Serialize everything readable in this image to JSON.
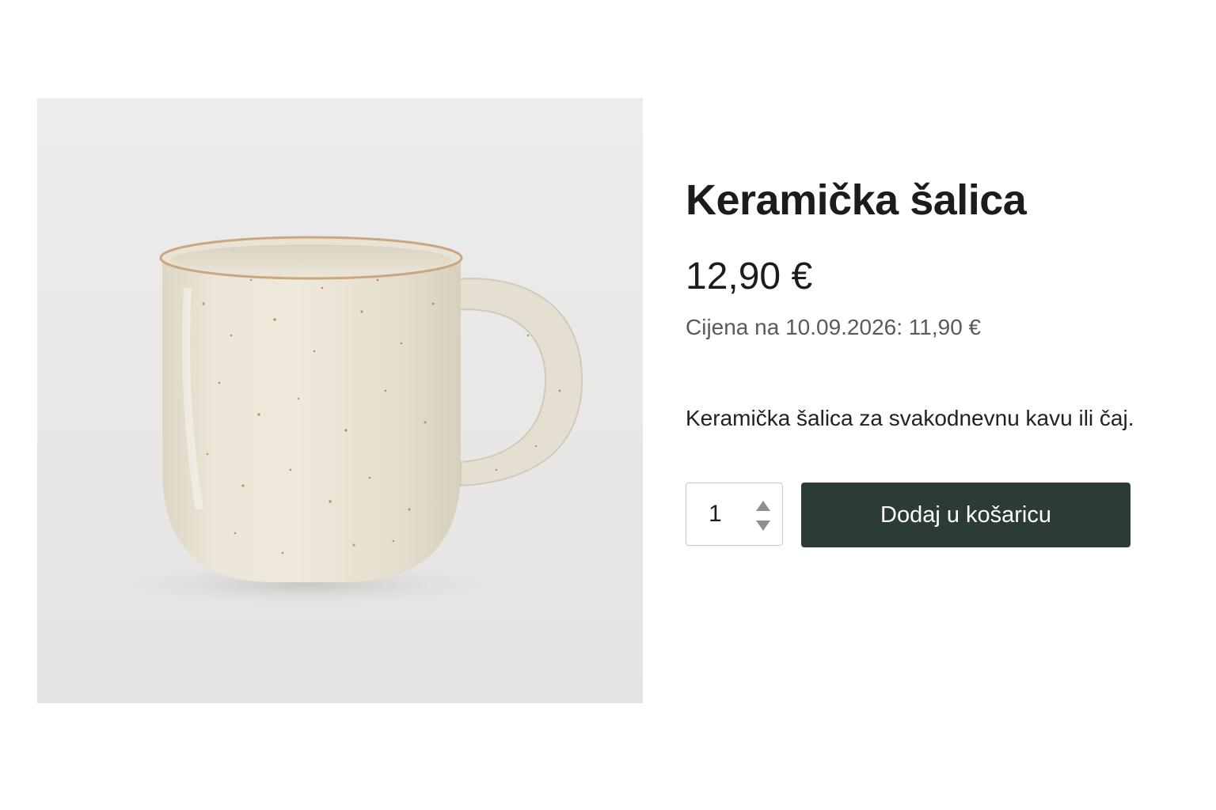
{
  "product": {
    "title": "Keramička šalica",
    "price": "12,90 €",
    "price_note": "Cijena na 10.09.2026: 11,90 €",
    "description": "Keramička šalica za svakodnevnu kavu ili čaj.",
    "image_icon": "mug-image"
  },
  "quantity": {
    "value": "1",
    "up_icon": "triangle-up-icon",
    "down_icon": "triangle-down-icon"
  },
  "cart": {
    "add_label": "Dodaj u košaricu",
    "button_color": "#2d3b35"
  }
}
